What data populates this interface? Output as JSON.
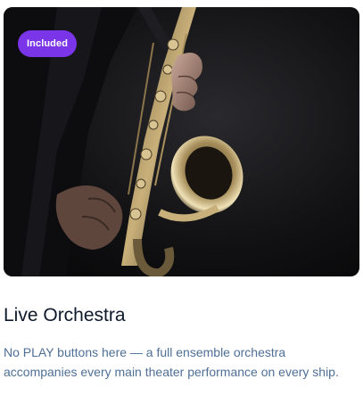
{
  "card": {
    "badge_label": "Included",
    "title": "Live Orchestra",
    "description": "No PLAY buttons here — a full ensemble orchestra accompanies every main theater performance on every ship.",
    "image": {
      "subject": "saxophone-player"
    }
  },
  "colors": {
    "badge_bg": "#7b35e8",
    "title": "#0e1a2b",
    "description": "#4f6f96"
  }
}
